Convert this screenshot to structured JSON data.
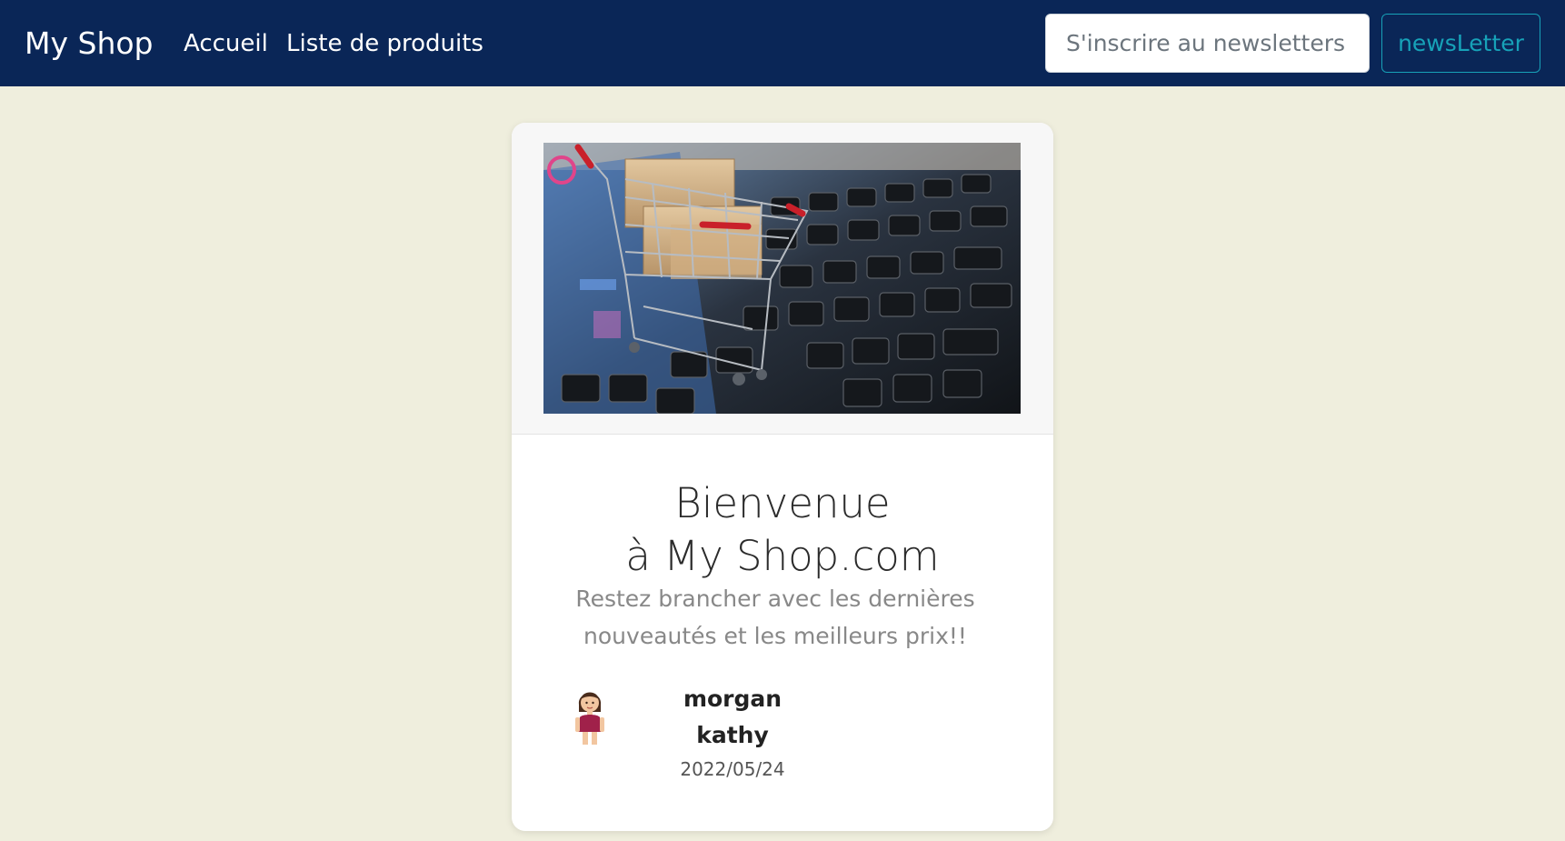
{
  "navbar": {
    "brand": "My Shop",
    "links": [
      "Accueil",
      "Liste de produits"
    ],
    "newsletter_placeholder": "S'inscrire au newsletters",
    "newsletter_button": "newsLetter"
  },
  "card": {
    "image_alt": "shopping-cart-on-laptop-keyboard",
    "title_line1": "Bienvenue",
    "title_line2": "à My Shop.com",
    "subtitle_line1": "Restez brancher avec les dernières",
    "subtitle_line2": "nouveautés et les meilleurs prix!!",
    "author_icon": "woman-avatar-icon",
    "author_first": "morgan",
    "author_last": "kathy",
    "date": "2022/05/24"
  },
  "colors": {
    "navbar_bg": "#0a2657",
    "page_bg": "#efeedd",
    "accent": "#17a2b8"
  }
}
